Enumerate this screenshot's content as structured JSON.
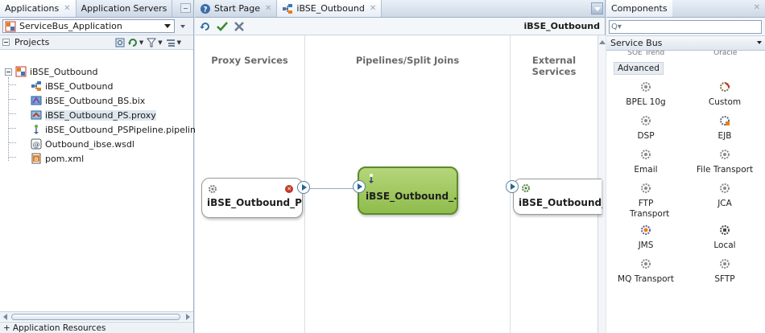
{
  "left": {
    "tabs": [
      {
        "label": "Applications",
        "active": true
      },
      {
        "label": "Application Servers",
        "active": false
      }
    ],
    "app_selector": {
      "value": "ServiceBus_Application"
    },
    "projects_label": "Projects",
    "tree": [
      {
        "label": "iBSE_Outbound",
        "icon": "project-icon",
        "level": 0
      },
      {
        "label": "iBSE_Outbound",
        "icon": "overview-icon",
        "level": 1
      },
      {
        "label": "iBSE_Outbound_BS.bix",
        "icon": "business-service-icon",
        "level": 1
      },
      {
        "label": "iBSE_Outbound_PS.proxy",
        "icon": "proxy-service-icon",
        "level": 1,
        "selected": true
      },
      {
        "label": "iBSE_Outbound_PSPipeline.pipeline",
        "icon": "pipeline-icon",
        "level": 1
      },
      {
        "label": "Outbound_ibse.wsdl",
        "icon": "wsdl-icon",
        "level": 1
      },
      {
        "label": "pom.xml",
        "icon": "xml-file-icon",
        "level": 1
      }
    ],
    "app_resources": "Application Resources"
  },
  "center": {
    "tabs": [
      {
        "label": "Start Page",
        "active": false
      },
      {
        "label": "iBSE_Outbound",
        "active": true
      }
    ],
    "toolbar_title": "iBSE_Outbound",
    "lanes": [
      "Proxy Services",
      "Pipelines/Split Joins",
      "External Services"
    ],
    "nodes": {
      "proxy": "iBSE_Outbound_PS",
      "pipeline": "iBSE_Outbound_...",
      "external": "iBSE_Outbound_I"
    }
  },
  "right": {
    "tab": "Components",
    "search_placeholder": "Q▾",
    "palette_selected": "Service Bus",
    "cutoff_left": "SOE Trend",
    "cutoff_right": "Oracle",
    "section": "Advanced",
    "components": [
      {
        "label": "BPEL 10g",
        "icon": "gear-icon"
      },
      {
        "label": "Custom",
        "icon": "custom-gear-icon"
      },
      {
        "label": "DSP",
        "icon": "gear-icon"
      },
      {
        "label": "EJB",
        "icon": "ejb-gear-icon"
      },
      {
        "label": "Email",
        "icon": "gear-icon"
      },
      {
        "label": "File Transport",
        "icon": "gear-icon"
      },
      {
        "label": "FTP Transport",
        "icon": "gear-icon"
      },
      {
        "label": "JCA",
        "icon": "gear-icon"
      },
      {
        "label": "JMS",
        "icon": "jms-gear-icon"
      },
      {
        "label": "Local",
        "icon": "local-gear-icon"
      },
      {
        "label": "MQ Transport",
        "icon": "gear-icon"
      },
      {
        "label": "SFTP",
        "icon": "gear-icon"
      }
    ]
  },
  "colors": {
    "pipeline_fill": "#9cc55a",
    "connector_blue": "#236496",
    "error_red": "#c0392b"
  }
}
